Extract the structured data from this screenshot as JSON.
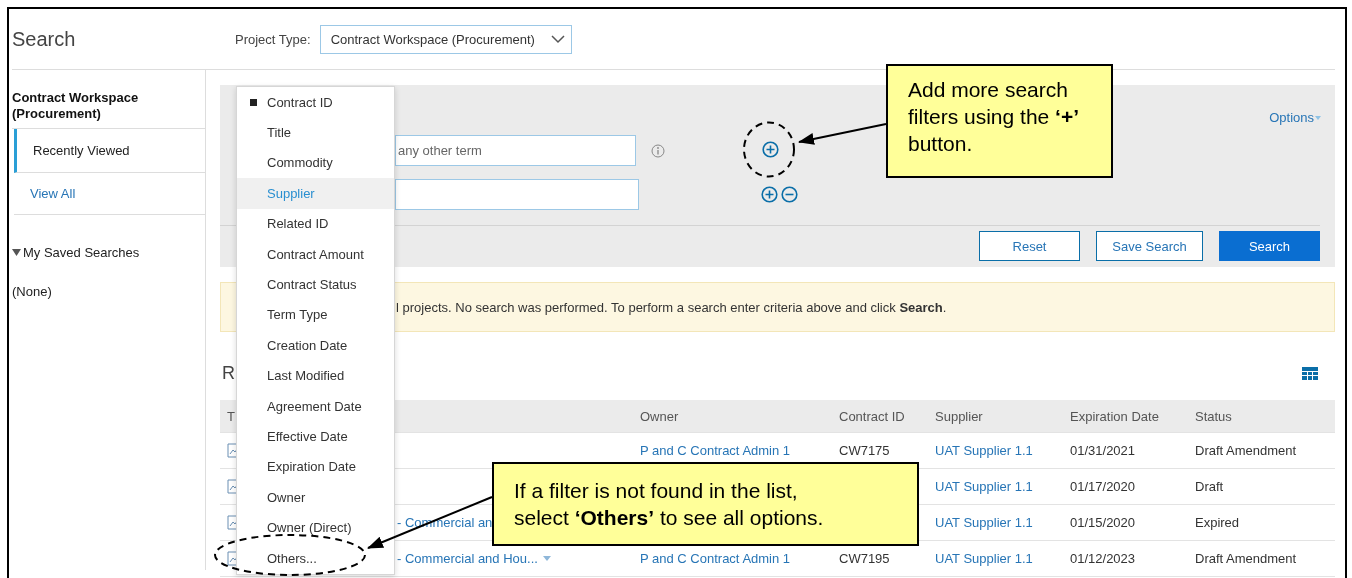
{
  "page_title": "Search",
  "project_type": {
    "label": "Project Type:",
    "value": "Contract Workspace (Procurement)"
  },
  "sidebar": {
    "heading": "Contract Workspace (Procurement)",
    "items": [
      {
        "label": "Recently Viewed",
        "selected": true
      },
      {
        "label": "View All",
        "selected": false
      }
    ],
    "saved_searches": {
      "label": "My Saved Searches",
      "expanded": true,
      "items": [
        "(None)"
      ]
    }
  },
  "search_panel": {
    "options_link": "Options",
    "keyword_field": {
      "placeholder": "any other term"
    },
    "buttons": [
      {
        "label": "Reset",
        "kind": "secondary"
      },
      {
        "label": "Save Search",
        "kind": "secondary"
      },
      {
        "label": "Search",
        "kind": "primary"
      }
    ]
  },
  "message": "l projects. No search was performed. To perform a search enter criteria above and click **Search**.",
  "results": {
    "heading": "R",
    "columns": [
      "T",
      "Owner",
      "Contract ID",
      "Supplier",
      "Expiration Date",
      "Status"
    ],
    "rows": [
      {
        "owner": "P and C Contract Admin 1",
        "contract_id": "CW7175",
        "supplier": "UAT Supplier 1.1",
        "expiration_date": "01/31/2021",
        "status": "Draft Amendment"
      },
      {
        "supplier": "UAT Supplier 1.1",
        "expiration_date": "01/17/2020",
        "status": "Draft"
      },
      {
        "title": "- Commercial an",
        "supplier": "UAT Supplier 1.1",
        "expiration_date": "01/15/2020",
        "status": "Expired"
      },
      {
        "title": "- Commercial and Hou...",
        "has_menu": true,
        "owner": "P and C Contract Admin 1",
        "contract_id": "CW7195",
        "supplier": "UAT Supplier 1.1",
        "expiration_date": "01/12/2023",
        "status": "Draft Amendment"
      }
    ]
  },
  "filter_menu": {
    "items": [
      {
        "label": "Contract ID",
        "checked": true,
        "selected": false
      },
      {
        "label": "Title",
        "checked": false,
        "selected": false
      },
      {
        "label": "Commodity",
        "checked": false,
        "selected": false
      },
      {
        "label": "Supplier",
        "checked": false,
        "selected": true
      },
      {
        "label": "Related ID",
        "checked": false,
        "selected": false
      },
      {
        "label": "Contract Amount",
        "checked": false,
        "selected": false
      },
      {
        "label": "Contract Status",
        "checked": false,
        "selected": false
      },
      {
        "label": "Term Type",
        "checked": false,
        "selected": false
      },
      {
        "label": "Creation Date",
        "checked": false,
        "selected": false
      },
      {
        "label": "Last Modified",
        "checked": false,
        "selected": false
      },
      {
        "label": "Agreement Date",
        "checked": false,
        "selected": false
      },
      {
        "label": "Effective Date",
        "checked": false,
        "selected": false
      },
      {
        "label": "Expiration Date",
        "checked": false,
        "selected": false
      },
      {
        "label": "Owner",
        "checked": false,
        "selected": false
      },
      {
        "label": "Owner (Direct)",
        "checked": false,
        "selected": false
      },
      {
        "label": "Others...",
        "checked": false,
        "selected": false
      }
    ]
  },
  "callouts": [
    {
      "text": "Add more search filters using the **‘+’** button."
    },
    {
      "text": "If a filter is not found in the list, select **‘Others’** to see all options."
    }
  ]
}
